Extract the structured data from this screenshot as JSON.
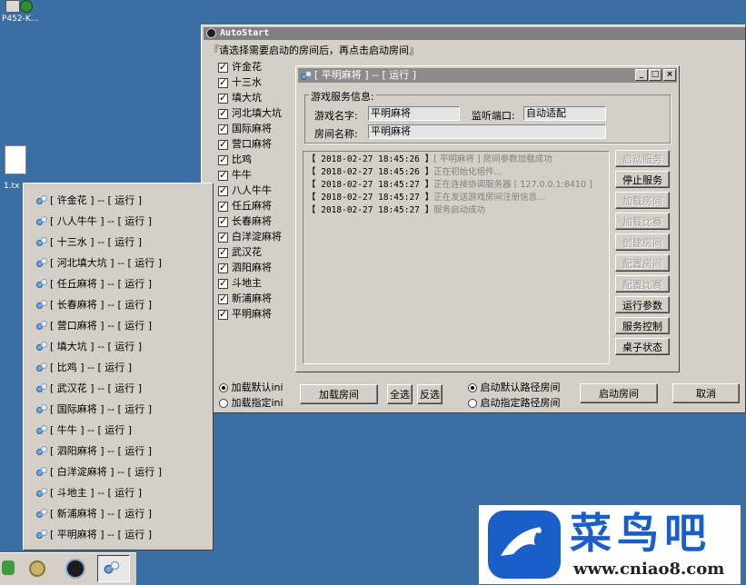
{
  "desktop": {
    "icon1_label": "P452-K...",
    "icon2_label": "1.tx"
  },
  "main_window": {
    "title": "AutoStart",
    "instruction": "『请选择需要启动的房间后，再点击启动房间』",
    "rooms": [
      "许金花",
      "十三水",
      "填大坑",
      "河北填大坑",
      "国际麻将",
      "营口麻将",
      "比鸡",
      "牛牛",
      "八人牛牛",
      "任丘麻将",
      "长春麻将",
      "白洋淀麻将",
      "武汉花",
      "泗阳麻将",
      "斗地主",
      "新浦麻将",
      "平明麻将"
    ],
    "radio_ini_default": "加载默认ini",
    "radio_ini_custom": "加载指定ini",
    "load_room_btn": "加载房间",
    "select_all_btn": "全选",
    "invert_btn": "反选",
    "radio_path_default": "启动默认路径房间",
    "radio_path_custom": "启动指定路径房间",
    "start_room_btn": "启动房间",
    "cancel_btn": "取消"
  },
  "inner_window": {
    "title": "[ 平明麻将 ] -- [ 运行 ]",
    "group_label": "游戏服务信息:",
    "game_name_label": "游戏名字:",
    "game_name_value": "平明麻将",
    "port_label": "监听端口:",
    "port_value": "自动适配",
    "room_name_label": "房间名称:",
    "room_name_value": "平明麻将",
    "logs": [
      {
        "time": "【 2018-02-27 18:45:26 】",
        "msg": "[ 平明麻将 ] 房间参数加载成功"
      },
      {
        "time": "【 2018-02-27 18:45:26 】",
        "msg": "正在初始化组件..."
      },
      {
        "time": "【 2018-02-27 18:45:27 】",
        "msg": "正在连接协调服务器 [ 127.0.0.1:8410 ]"
      },
      {
        "time": "【 2018-02-27 18:45:27 】",
        "msg": "正在发送游戏房间注册信息..."
      },
      {
        "time": "【 2018-02-27 18:45:27 】",
        "msg": "服务启动成功"
      }
    ],
    "buttons": [
      {
        "label": "启动服务",
        "enabled": false
      },
      {
        "label": "停止服务",
        "enabled": true
      },
      {
        "label": "加载房间",
        "enabled": false
      },
      {
        "label": "加载比赛",
        "enabled": false
      },
      {
        "label": "创建房间",
        "enabled": false
      },
      {
        "label": "配置房间",
        "enabled": false
      },
      {
        "label": "配置比赛",
        "enabled": false
      },
      {
        "label": "运行参数",
        "enabled": true
      },
      {
        "label": "服务控制",
        "enabled": true
      },
      {
        "label": "桌子状态",
        "enabled": true
      }
    ]
  },
  "task_list": {
    "items": [
      "[ 许金花 ] -- [ 运行 ]",
      "[ 八人牛牛 ] -- [ 运行 ]",
      "[ 十三水 ] -- [ 运行 ]",
      "[ 河北填大坑 ] -- [ 运行 ]",
      "[ 任丘麻将 ] -- [ 运行 ]",
      "[ 长春麻将 ] -- [ 运行 ]",
      "[ 营口麻将 ] -- [ 运行 ]",
      "[ 填大坑 ] -- [ 运行 ]",
      "[ 比鸡 ] -- [ 运行 ]",
      "[ 武汉花 ] -- [ 运行 ]",
      "[ 国际麻将 ] -- [ 运行 ]",
      "[ 牛牛 ] -- [ 运行 ]",
      "[ 泗阳麻将 ] -- [ 运行 ]",
      "[ 白洋淀麻将 ] -- [ 运行 ]",
      "[ 斗地主 ] -- [ 运行 ]",
      "[ 新浦麻将 ] -- [ 运行 ]",
      "[ 平明麻将 ] -- [ 运行 ]"
    ]
  },
  "watermark": {
    "brand": "菜鸟吧",
    "url": "www.cniao8.com"
  },
  "colors": {
    "desktop": "#3a6ea5",
    "window_face": "#d4d0c8",
    "title_bar": "#808080",
    "inner_title_bar": "#8c8c8c",
    "watermark_blue": "#1a5fc7"
  }
}
